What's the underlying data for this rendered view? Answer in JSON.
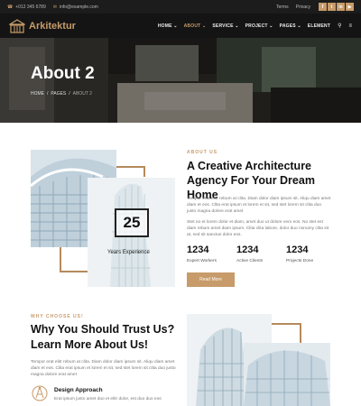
{
  "topbar": {
    "phone": "+012 345 6789",
    "email": "info@example.com",
    "links": [
      "Terms",
      "Privacy"
    ],
    "socials": [
      "f",
      "t",
      "in",
      "▶"
    ]
  },
  "nav": {
    "logo": "Arkitektur",
    "items": [
      "HOME",
      "ABOUT",
      "SERVICE",
      "PROJECT",
      "PAGES",
      "ELEMENT"
    ],
    "active": "ABOUT"
  },
  "hero": {
    "title": "About 2",
    "breadcrumb": [
      "HOME",
      "/",
      "PAGES",
      "/",
      "ABOUT 2"
    ]
  },
  "about": {
    "tag": "ABOUT US",
    "heading": "A Creative Architecture Agency For Your Dream Home",
    "para1": "Tempor erat elitr rebum at clita. Diam dolor diam ipsum sit. Aliqu diam amet diam et eos. Clita erat ipsum et lorem et sit, sed stet lorem sit clita duo justo magna dolore erat amet",
    "para2": "Stet no et lorem dolor et diam, amet duo ut dolore vero eos. No stet est diam rebum amet diam ipsum. Clita clita labore, dolor duo nonumy clita sit at, sed sit sanctus dolor eos.",
    "years": "25",
    "years_label": "Years Experience",
    "stats": [
      {
        "num": "1234",
        "label": "Expert Workers"
      },
      {
        "num": "1234",
        "label": "Active Clients"
      },
      {
        "num": "1234",
        "label": "Projects Done"
      }
    ],
    "button": "Read More"
  },
  "why": {
    "tag": "WHY CHOOSE US!",
    "heading": "Why You Should Trust Us? Learn More About Us!",
    "para": "Tempor erat elitr rebum at clita. Diam dolor diam ipsum sit. Aliqu diam amet diam et eos. Clita erat ipsum et lorem et sit, sed stet lorem sit clita duo justo magna dolore erat amet",
    "feature_title": "Design Approach",
    "feature_desc": "Erat ipsum justo amet duo et elitr dolor, est duo duo eos"
  },
  "colors": {
    "accent": "#c79b6a",
    "dark": "#141414"
  }
}
